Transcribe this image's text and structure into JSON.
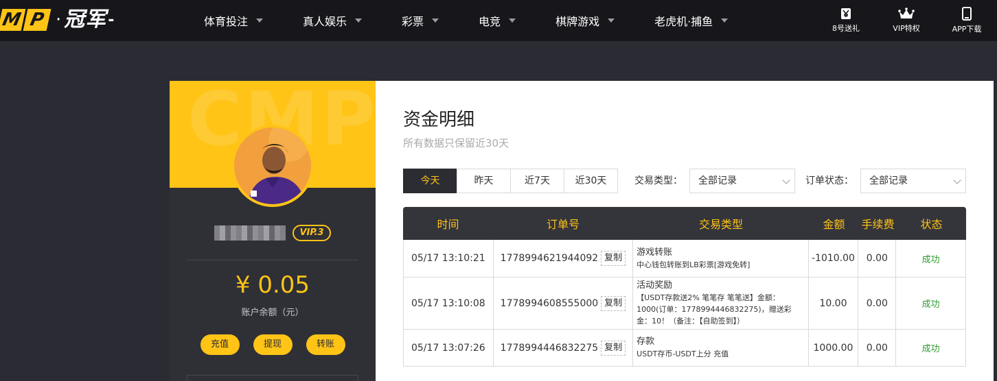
{
  "logo": {
    "mp": [
      "M",
      "P"
    ],
    "dot": "·",
    "cn": "冠军",
    "tail": "-"
  },
  "nav": [
    {
      "label": "体育投注"
    },
    {
      "label": "真人娱乐"
    },
    {
      "label": "彩票"
    },
    {
      "label": "电竞"
    },
    {
      "label": "棋牌游戏"
    },
    {
      "label": "老虎机·捕鱼"
    }
  ],
  "tools": [
    {
      "label": "8号送礼",
      "icon": "gift-icon"
    },
    {
      "label": "VIP特权",
      "icon": "crown-icon"
    },
    {
      "label": "APP下载",
      "icon": "phone-icon"
    }
  ],
  "profile": {
    "banner_watermark": "CMP",
    "vip": "VIP.3",
    "balance": "¥ 0.05",
    "balance_label": "账户余额（元）",
    "actions": [
      "充值",
      "提现",
      "转账"
    ]
  },
  "main": {
    "title": "资金明细",
    "subtitle": "所有数据只保留近30天",
    "date_tabs": [
      "今天",
      "昨天",
      "近7天",
      "近30天"
    ],
    "type_filter": {
      "label": "交易类型：",
      "value": "全部记录"
    },
    "status_filter": {
      "label": "订单状态：",
      "value": "全部记录"
    },
    "table": {
      "headers": [
        "时间",
        "订单号",
        "交易类型",
        "金额",
        "手续费",
        "状态"
      ],
      "copy_label": "复制",
      "rows": [
        {
          "time": "05/17 13:10:21",
          "order": "1778994621944092",
          "type_title": "游戏转账",
          "type_detail": "中心钱包转账到LB彩票[游戏免转]",
          "amount": "-1010.00",
          "fee": "0.00",
          "status": "成功"
        },
        {
          "time": "05/17 13:10:08",
          "order": "1778994608555000",
          "type_title": "活动奖励",
          "type_detail": "【USDT存款送2% 笔笔存 笔笔送】金额：1000(订单：1778994446832275)，赠送彩金：10！（备注：【自助签到】）",
          "amount": "10.00",
          "fee": "0.00",
          "status": "成功"
        },
        {
          "time": "05/17 13:07:26",
          "order": "1778994446832275",
          "type_title": "存款",
          "type_detail": "USDT存币-USDT上分 充值",
          "amount": "1000.00",
          "fee": "0.00",
          "status": "成功"
        }
      ]
    }
  },
  "colors": {
    "accent": "#ffc416",
    "dark": "#17171b",
    "panel": "#2f2f36",
    "success": "#2f9a2f"
  }
}
